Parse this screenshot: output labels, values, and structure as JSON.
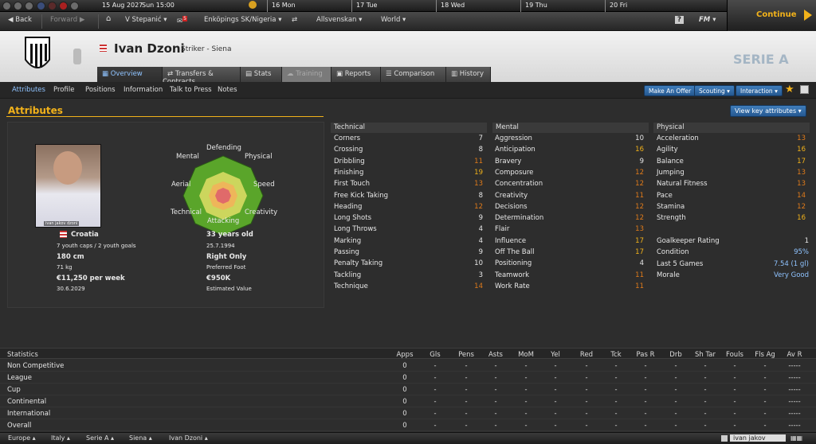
{
  "topbar": {
    "date": "15 Aug 2027",
    "time": "Sun 15:00",
    "days": [
      {
        "num": "16",
        "name": "Mon"
      },
      {
        "num": "17",
        "name": "Tue"
      },
      {
        "num": "18",
        "name": "Wed"
      },
      {
        "num": "19",
        "name": "Thu"
      },
      {
        "num": "20",
        "name": "Fri"
      }
    ]
  },
  "nav": {
    "back": "Back",
    "forward": "Forward",
    "manager": "V Stepanić",
    "inbox_count": "5",
    "club": "Enköpings SK/Nigeria",
    "league": "Allsvenskan",
    "world": "World",
    "help": "?",
    "fm": "FM",
    "continue": "Continue"
  },
  "player": {
    "name": "Ivan Dzoni",
    "role": "Striker - Siena",
    "club_badge": "A.C. SIENA",
    "league_logo": "SERIE A",
    "photo_caption": "ivan jakov dzoni"
  },
  "tabs": [
    {
      "label": "Overview",
      "active": true
    },
    {
      "label": "Transfers & Contracts"
    },
    {
      "label": "Stats"
    },
    {
      "label": "Training",
      "disabled": true
    },
    {
      "label": "Reports"
    },
    {
      "label": "Comparison"
    },
    {
      "label": "History"
    }
  ],
  "subnav": [
    "Attributes",
    "Profile",
    "Positions",
    "Information",
    "Talk to Press",
    "Notes"
  ],
  "actions": {
    "offer": "Make An Offer",
    "scouting": "Scouting",
    "interaction": "Interaction",
    "view_key": "View key attributes"
  },
  "section_title": "Attributes",
  "radar_labels": {
    "defending": "Defending",
    "physical": "Physical",
    "speed": "Speed",
    "creativity": "Creativity",
    "attacking": "Attacking",
    "technical": "Technical",
    "aerial": "Aerial",
    "mental": "Mental"
  },
  "info": {
    "nation": "Croatia",
    "caps": "7 youth caps / 2 youth goals",
    "age": "33 years old",
    "dob": "25.7.1994",
    "height": "180 cm",
    "foot": "Right Only",
    "weight": "71 kg",
    "foot_label": "Preferred Foot",
    "wage": "€11,250 per week",
    "value": "€950K",
    "contract": "30.6.2029",
    "value_label": "Estimated Value"
  },
  "technical": {
    "title": "Technical",
    "rows": [
      [
        "Corners",
        "7"
      ],
      [
        "Crossing",
        "8"
      ],
      [
        "Dribbling",
        "11"
      ],
      [
        "Finishing",
        "19"
      ],
      [
        "First Touch",
        "13"
      ],
      [
        "Free Kick Taking",
        "8"
      ],
      [
        "Heading",
        "12"
      ],
      [
        "Long Shots",
        "9"
      ],
      [
        "Long Throws",
        "4"
      ],
      [
        "Marking",
        "4"
      ],
      [
        "Passing",
        "9"
      ],
      [
        "Penalty Taking",
        "10"
      ],
      [
        "Tackling",
        "3"
      ],
      [
        "Technique",
        "14"
      ]
    ]
  },
  "mental": {
    "title": "Mental",
    "rows": [
      [
        "Aggression",
        "10"
      ],
      [
        "Anticipation",
        "16"
      ],
      [
        "Bravery",
        "9"
      ],
      [
        "Composure",
        "12"
      ],
      [
        "Concentration",
        "12"
      ],
      [
        "Creativity",
        "11"
      ],
      [
        "Decisions",
        "12"
      ],
      [
        "Determination",
        "12"
      ],
      [
        "Flair",
        "13"
      ],
      [
        "Influence",
        "17"
      ],
      [
        "Off The Ball",
        "17"
      ],
      [
        "Positioning",
        "4"
      ],
      [
        "Teamwork",
        "11"
      ],
      [
        "Work Rate",
        "11"
      ]
    ]
  },
  "physical": {
    "title": "Physical",
    "rows": [
      [
        "Acceleration",
        "13"
      ],
      [
        "Agility",
        "16"
      ],
      [
        "Balance",
        "17"
      ],
      [
        "Jumping",
        "13"
      ],
      [
        "Natural Fitness",
        "13"
      ],
      [
        "Pace",
        "14"
      ],
      [
        "Stamina",
        "12"
      ],
      [
        "Strength",
        "16"
      ]
    ],
    "extra": [
      [
        "Goalkeeper Rating",
        "1"
      ],
      [
        "Condition",
        "95%"
      ],
      [
        "Last 5 Games",
        "7.54 (1 gl)"
      ],
      [
        "Morale",
        "Very Good"
      ]
    ]
  },
  "stats": {
    "title": "Statistics",
    "headers": [
      "Apps",
      "Gls",
      "Pens",
      "Asts",
      "MoM",
      "Yel",
      "Red",
      "Tck",
      "Pas R",
      "Drb",
      "Sh Tar",
      "Fouls",
      "Fls Ag",
      "Av R"
    ],
    "rows": [
      {
        "label": "Non Competitive",
        "apps": "0"
      },
      {
        "label": "League",
        "apps": "0"
      },
      {
        "label": "Cup",
        "apps": "0"
      },
      {
        "label": "Continental",
        "apps": "0"
      },
      {
        "label": "International",
        "apps": "0"
      },
      {
        "label": "Overall",
        "apps": "0"
      }
    ],
    "dash": "-",
    "avr": "-----"
  },
  "bottom": {
    "crumbs": [
      "Europe",
      "Italy",
      "Serie A",
      "Siena",
      "Ivan Dzoni"
    ],
    "user": "ivan jakov"
  },
  "colors": {
    "accent": "#f2b21a",
    "high": "#f2b21a",
    "mid": "#e07b1a",
    "low": "#9a9a9a",
    "blue": "#8fc3ff"
  }
}
